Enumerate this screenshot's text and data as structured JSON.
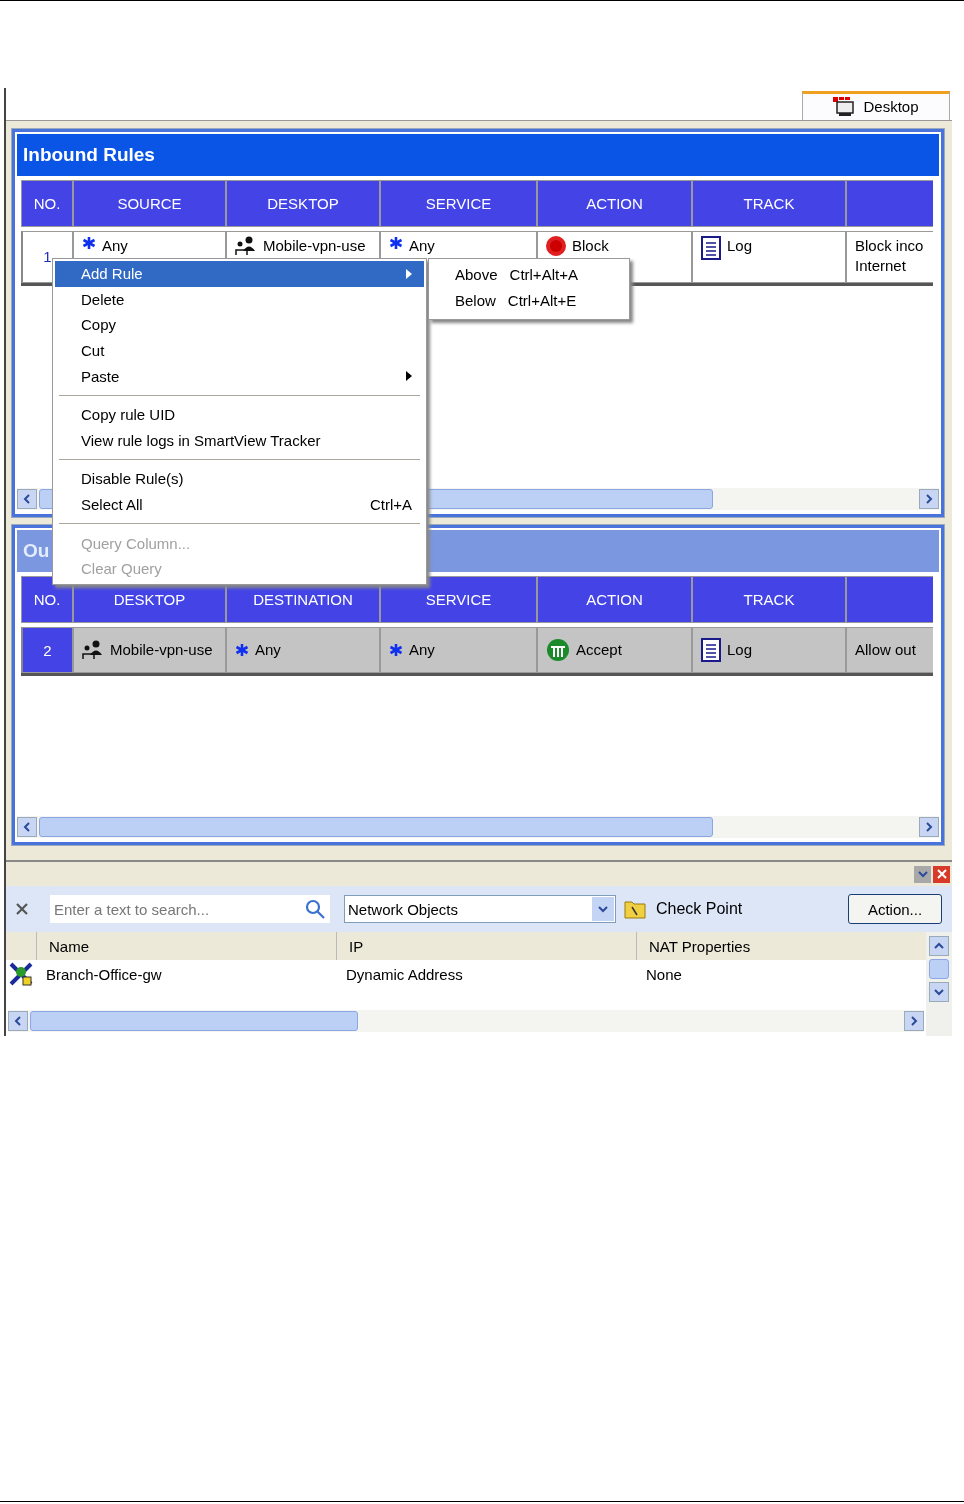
{
  "tabs": [
    {
      "label": "Desktop",
      "selected": true
    }
  ],
  "inbound": {
    "title": "Inbound Rules",
    "active": true,
    "columns": [
      "NO.",
      "SOURCE",
      "DESKTOP",
      "SERVICE",
      "ACTION",
      "TRACK"
    ],
    "rows": [
      {
        "selected": false,
        "cells": [
          {
            "kind": "number",
            "text": "1"
          },
          {
            "kind": "any",
            "text": "Any"
          },
          {
            "kind": "user",
            "text": "Mobile-vpn-use"
          },
          {
            "kind": "any",
            "text": "Any"
          },
          {
            "kind": "block",
            "text": "Block"
          },
          {
            "kind": "log",
            "text": "Log"
          },
          {
            "kind": "plain",
            "text": "Block inco\nInternet"
          }
        ]
      }
    ]
  },
  "outbound": {
    "title": "Ou",
    "active": false,
    "columns": [
      "NO.",
      "DESKTOP",
      "DESTINATION",
      "SERVICE",
      "ACTION",
      "TRACK"
    ],
    "rows": [
      {
        "selected": true,
        "cells": [
          {
            "kind": "number",
            "text": "2"
          },
          {
            "kind": "user",
            "text": "Mobile-vpn-use"
          },
          {
            "kind": "any",
            "text": "Any"
          },
          {
            "kind": "any",
            "text": "Any"
          },
          {
            "kind": "accept",
            "text": "Accept"
          },
          {
            "kind": "log",
            "text": "Log"
          },
          {
            "kind": "plain",
            "text": "Allow out"
          }
        ]
      }
    ]
  },
  "context_menu": {
    "groups": [
      [
        {
          "label": "Add Rule",
          "selected": true,
          "disabled": false,
          "submenu": true
        },
        {
          "label": "Delete",
          "selected": false,
          "disabled": false,
          "submenu": false
        },
        {
          "label": "Copy",
          "selected": false,
          "disabled": false,
          "submenu": false
        },
        {
          "label": "Cut",
          "selected": false,
          "disabled": false,
          "submenu": false
        },
        {
          "label": "Paste",
          "selected": false,
          "disabled": false,
          "submenu": true
        }
      ],
      [
        {
          "label": "Copy rule UID",
          "selected": false,
          "disabled": false,
          "submenu": false
        },
        {
          "label": "View rule logs in SmartView Tracker",
          "selected": false,
          "disabled": false,
          "submenu": false
        }
      ],
      [
        {
          "label": "Disable Rule(s)",
          "selected": false,
          "disabled": false,
          "submenu": false
        },
        {
          "label": "Select All",
          "shortcut": "Ctrl+A",
          "selected": false,
          "disabled": false,
          "submenu": false
        }
      ],
      [
        {
          "label": "Query Column...",
          "selected": false,
          "disabled": true,
          "submenu": false
        },
        {
          "label": "Clear Query",
          "selected": false,
          "disabled": true,
          "submenu": false
        }
      ]
    ],
    "submenu": [
      {
        "label": "Above",
        "shortcut": "Ctrl+Alt+A"
      },
      {
        "label": "Below",
        "shortcut": "Ctrl+Alt+E"
      }
    ]
  },
  "objects_pane": {
    "search": {
      "placeholder": "Enter a text to search..."
    },
    "category": "Network Objects",
    "folder": "Check Point",
    "action_button": "Action...",
    "columns": [
      "Name",
      "IP",
      "NAT Properties"
    ],
    "rows": [
      {
        "name": "Branch-Office-gw",
        "ip": "Dynamic Address",
        "nat": "None"
      }
    ]
  }
}
